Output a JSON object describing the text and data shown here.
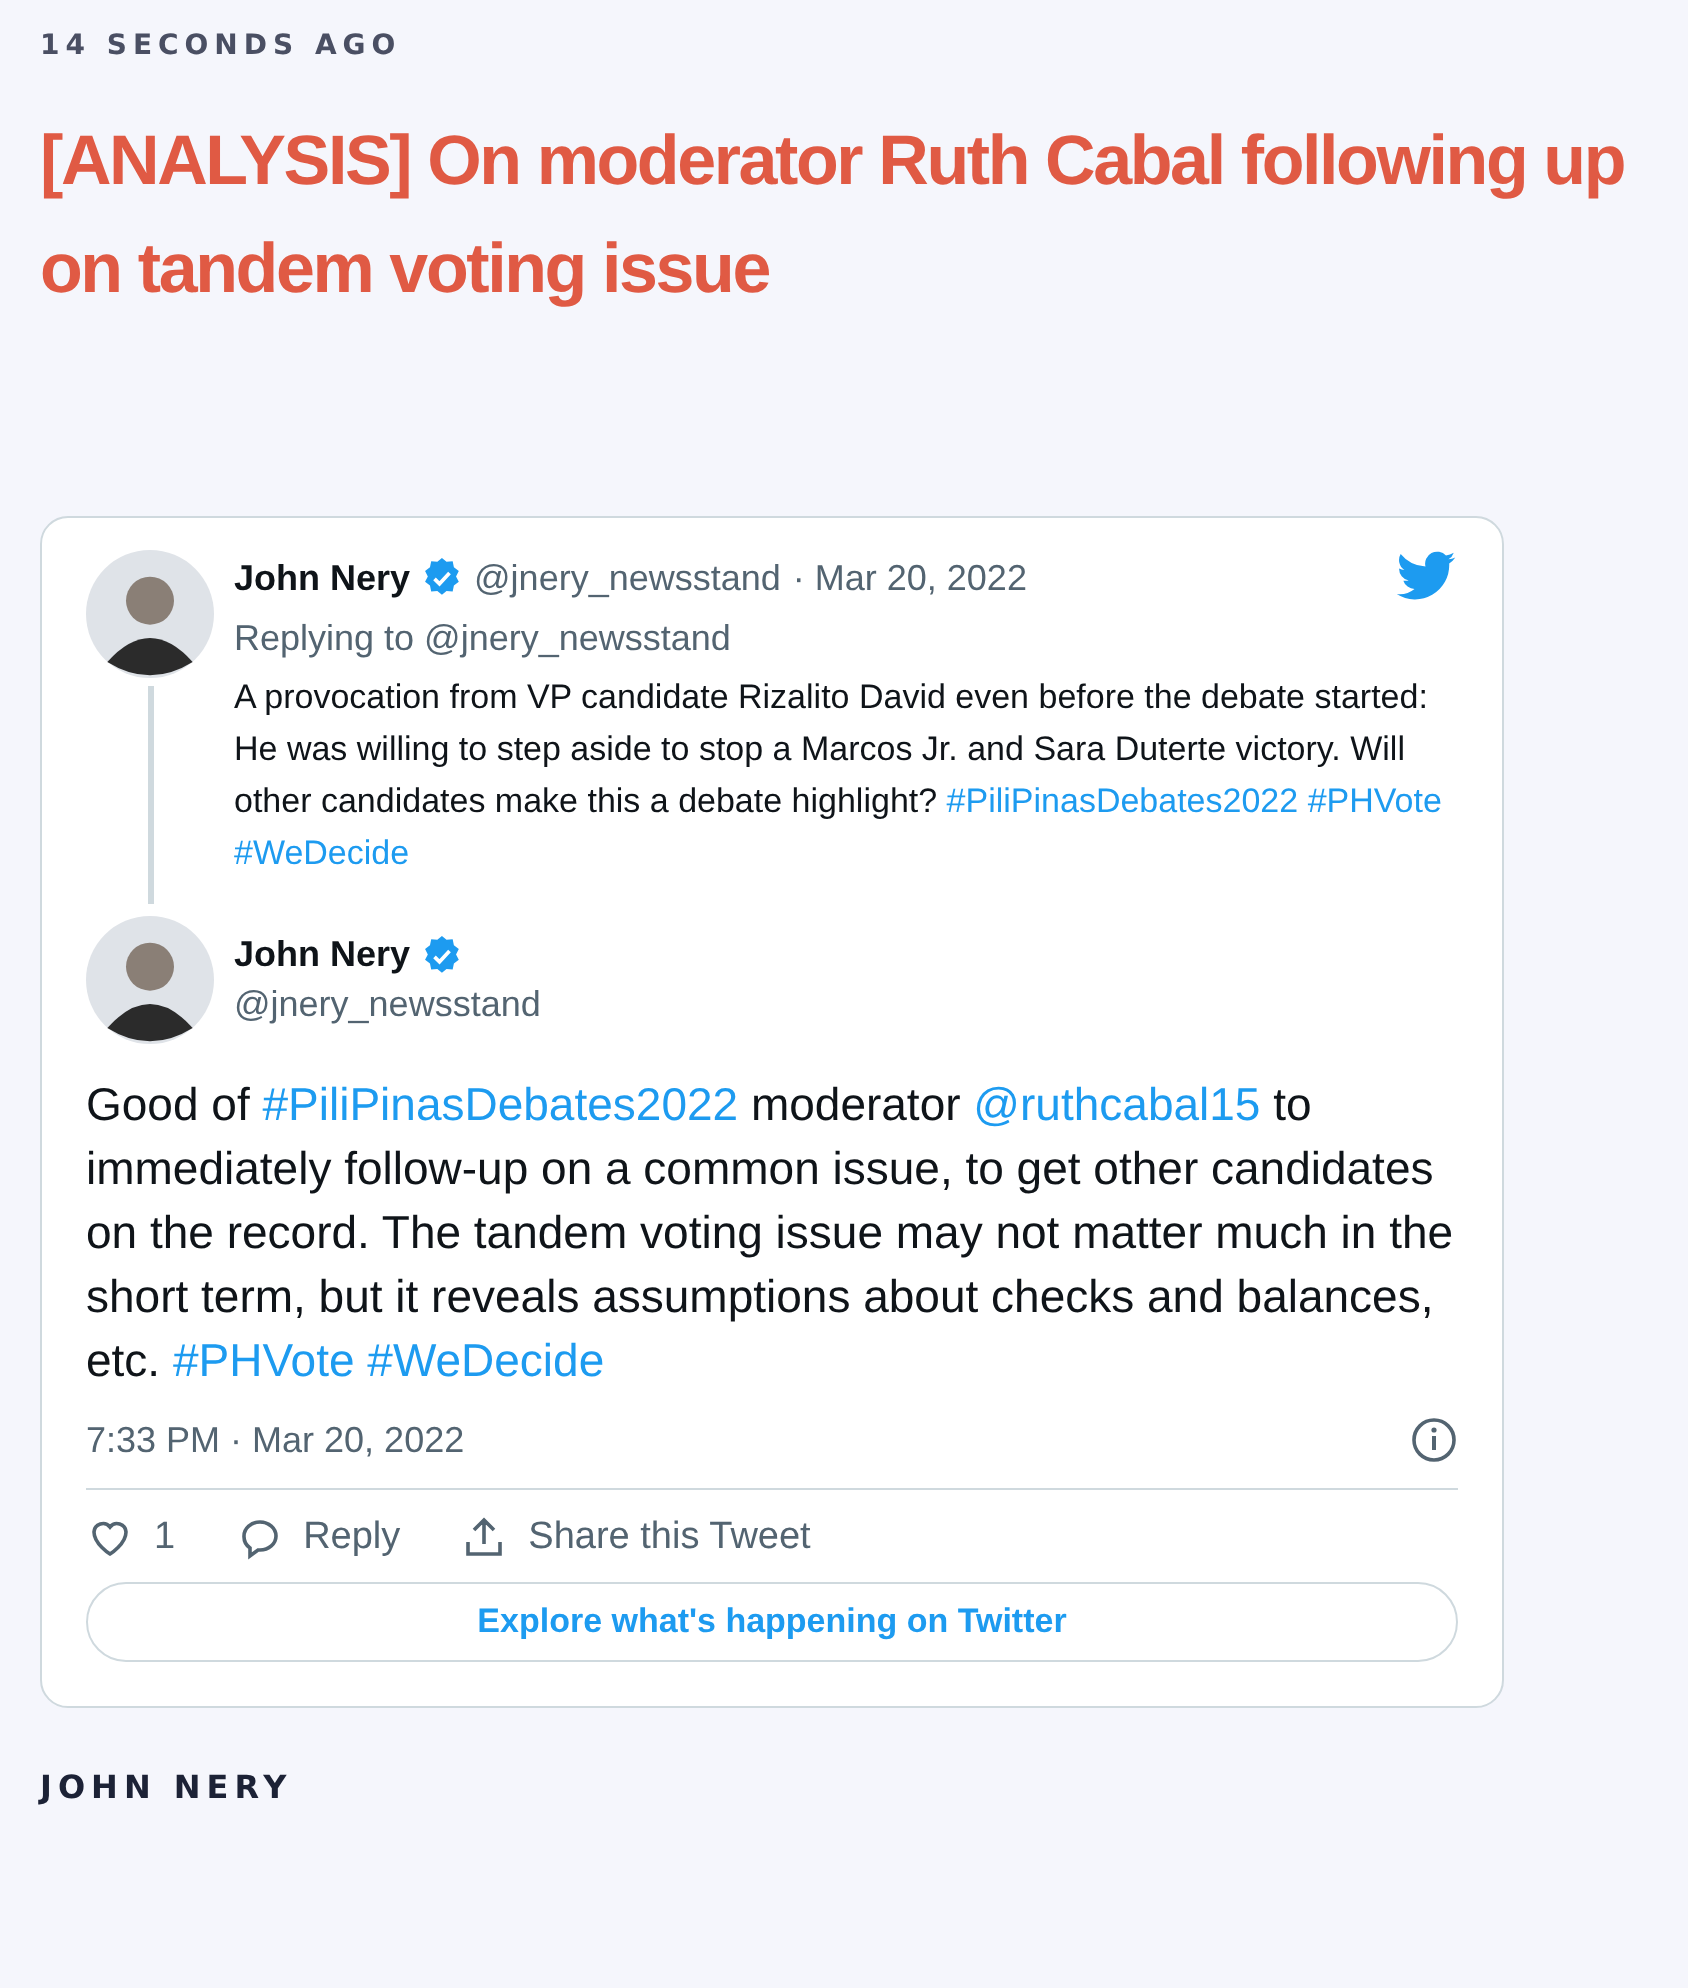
{
  "timestamp": "14 SECONDS AGO",
  "headline": "[ANALYSIS] On moderator Ruth Cabal following up on tandem voting issue",
  "embed": {
    "parent_tweet": {
      "name": "John Nery",
      "verified": true,
      "handle": "@jnery_newsstand",
      "date": "· Mar 20, 2022",
      "replying_to": "Replying to @jnery_newsstand",
      "segments": [
        {
          "kind": "text",
          "text": "A provocation from VP candidate Rizalito David even before the debate started: He was willing to step aside to stop a Marcos Jr. and Sara Duterte victory. Will other candidates make this a debate highlight? "
        },
        {
          "kind": "link",
          "text": "#PiliPinasDebates2022"
        },
        {
          "kind": "link",
          "text": "#PHVote"
        },
        {
          "kind": "link",
          "text": "#WeDecide"
        }
      ]
    },
    "tweet": {
      "name": "John Nery",
      "verified": true,
      "handle": "@jnery_newsstand",
      "segments": [
        {
          "kind": "text",
          "text": "Good of "
        },
        {
          "kind": "link",
          "text": "#PiliPinasDebates2022"
        },
        {
          "kind": "text",
          "text": " moderator "
        },
        {
          "kind": "link",
          "text": "@ruthcabal15"
        },
        {
          "kind": "text",
          "text": " to immediately follow-up on a common issue, to get other candidates on the record. The tandem voting issue may not matter much in the short term, but it reveals assumptions about checks and balances, etc. "
        },
        {
          "kind": "link",
          "text": "#PHVote"
        },
        {
          "kind": "link",
          "text": "#WeDecide"
        }
      ],
      "time": "7:33 PM · Mar 20, 2022"
    },
    "actions": [
      {
        "kind": "like",
        "label": "1"
      },
      {
        "kind": "reply",
        "label": "Reply"
      },
      {
        "kind": "share",
        "label": "Share this Tweet"
      }
    ],
    "explore_button": "Explore what's happening on Twitter"
  },
  "author": "JOHN NERY"
}
